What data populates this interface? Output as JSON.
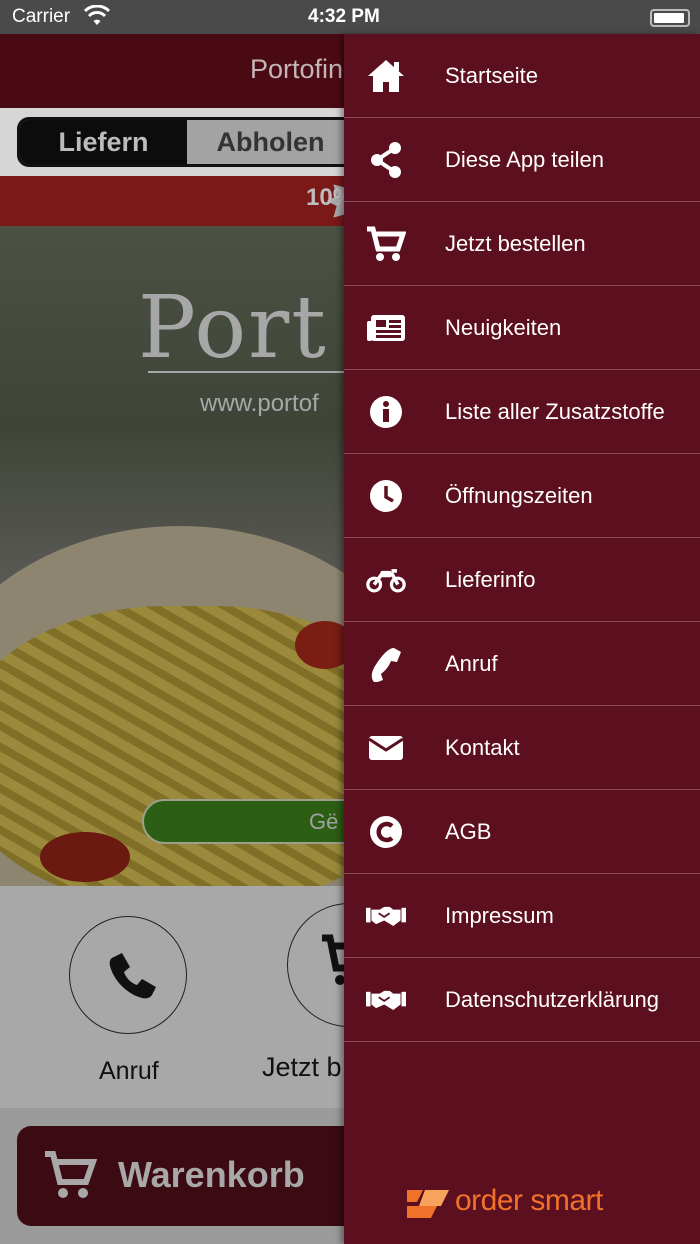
{
  "status_bar": {
    "carrier": "Carrier",
    "time": "4:32 PM"
  },
  "navbar": {
    "title": "Portofin"
  },
  "order_mode": {
    "deliver": "Liefern",
    "pickup": "Abholen"
  },
  "promo": {
    "text": "10%"
  },
  "hero": {
    "logo_text": "Port",
    "url": "www.portof",
    "open_status": "Gё"
  },
  "quick_actions": {
    "call_label": "Anruf",
    "order_label": "Jetzt b"
  },
  "cart": {
    "label": "Warenkorb"
  },
  "drawer": {
    "items": [
      {
        "label": "Startseite",
        "icon": "home-icon"
      },
      {
        "label": "Diese App teilen",
        "icon": "share-icon"
      },
      {
        "label": "Jetzt bestellen",
        "icon": "cart-icon"
      },
      {
        "label": "Neuigkeiten",
        "icon": "newspaper-icon"
      },
      {
        "label": "Liste aller Zusatzstoffe",
        "icon": "info-icon"
      },
      {
        "label": "Öffnungszeiten",
        "icon": "clock-icon"
      },
      {
        "label": "Lieferinfo",
        "icon": "motorcycle-icon"
      },
      {
        "label": "Anruf",
        "icon": "phone-icon"
      },
      {
        "label": "Kontakt",
        "icon": "envelope-icon"
      },
      {
        "label": "AGB",
        "icon": "copyright-icon"
      },
      {
        "label": "Impressum",
        "icon": "handshake-icon"
      },
      {
        "label": "Datenschutzerklärung",
        "icon": "handshake-icon"
      }
    ],
    "footer_brand": "order smart"
  },
  "colors": {
    "drawer_bg": "#5c0f1f",
    "brand_orange": "#f0722a",
    "promo_red": "#b32222"
  }
}
